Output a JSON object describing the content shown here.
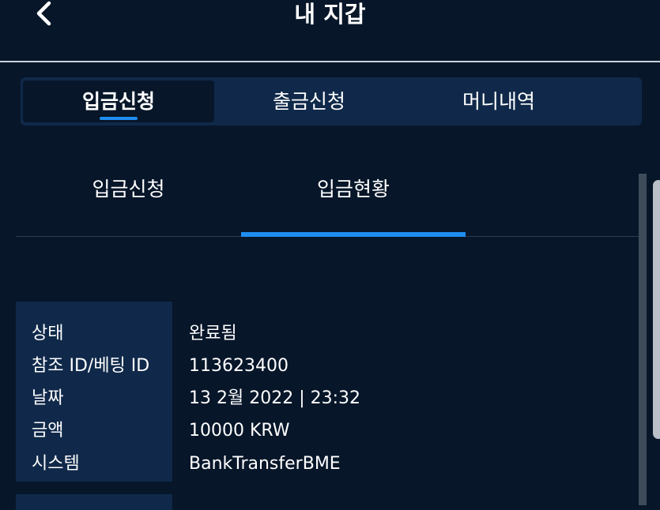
{
  "header": {
    "title": "내 지갑",
    "back_icon": "chevron-left-icon"
  },
  "tabs": [
    {
      "label": "입금신청",
      "active": true
    },
    {
      "label": "출금신청",
      "active": false
    },
    {
      "label": "머니내역",
      "active": false
    }
  ],
  "subtabs": [
    {
      "label": "입금신청",
      "active": false
    },
    {
      "label": "입금현황",
      "active": true
    }
  ],
  "deposit": {
    "rows": [
      {
        "label": "상태",
        "value": "완료됨"
      },
      {
        "label": "참조 ID/베팅 ID",
        "value": "113623400"
      },
      {
        "label": "날짜",
        "value": "13 2월 2022 | 23:32"
      },
      {
        "label": "금액",
        "value": "10000 KRW"
      },
      {
        "label": "시스템",
        "value": "BankTransferBME"
      }
    ]
  },
  "colors": {
    "background": "#071629",
    "panel": "#10294a",
    "accent": "#1f8ef0",
    "text": "#ffffff"
  }
}
